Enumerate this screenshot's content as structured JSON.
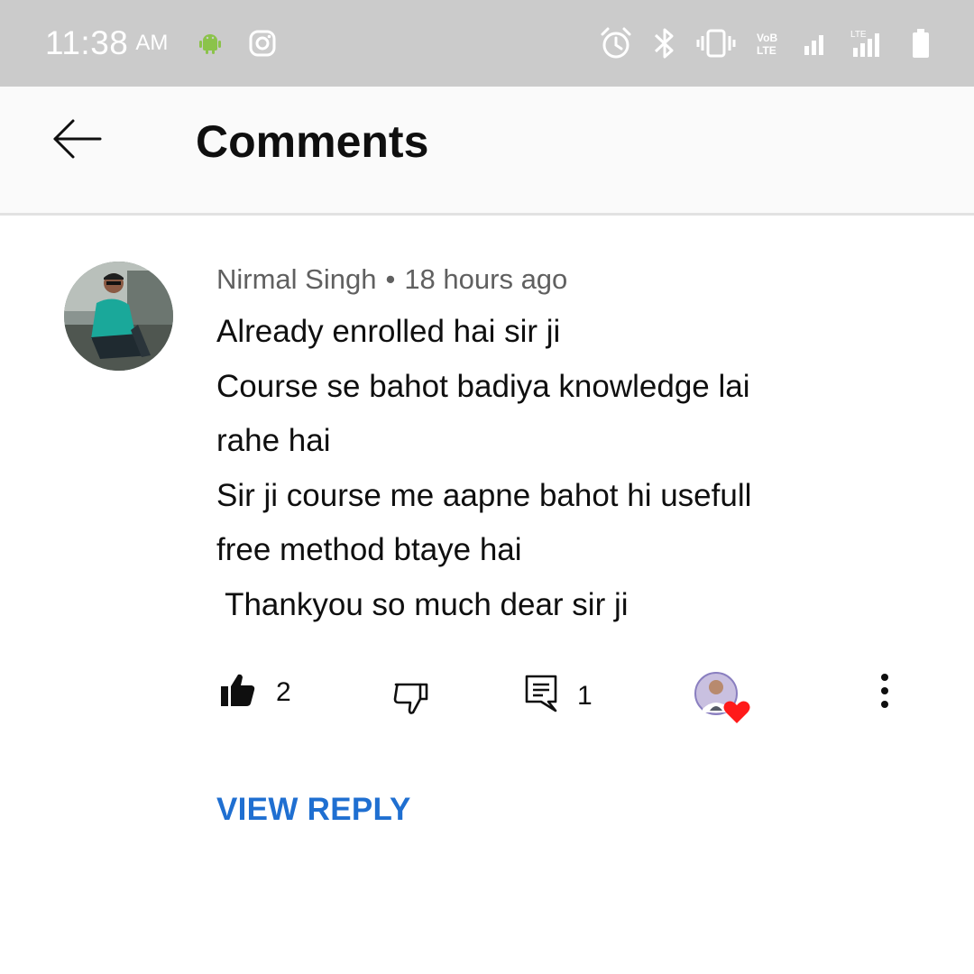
{
  "status_bar": {
    "time": "11:38",
    "ampm": "AM",
    "left_icons": [
      "android-icon",
      "instagram-icon"
    ],
    "right_icons": [
      "alarm-icon",
      "bluetooth-icon",
      "vibrate-icon",
      "volte-icon",
      "signal-icon",
      "lte-signal-icon",
      "battery-icon"
    ]
  },
  "header": {
    "title": "Comments",
    "back_icon": "back-arrow-icon"
  },
  "comment": {
    "author": "Nirmal Singh",
    "separator": "•",
    "timestamp": "18 hours ago",
    "lines": [
      "Already enrolled hai sir ji",
      "Course se bahot badiya knowledge lai",
      "rahe hai",
      "Sir ji course me aapne bahot hi usefull",
      "free method btaye hai",
      " Thankyou so much dear sir ji"
    ],
    "like_count": "2",
    "reply_count": "1",
    "view_reply_label": "VIEW REPLY"
  },
  "colors": {
    "status_bar_bg": "#cbcbcb",
    "app_bar_bg": "#fafafa",
    "link_blue": "#1f6fd1",
    "heart_red": "#ff0000",
    "meta_gray": "#606060"
  }
}
